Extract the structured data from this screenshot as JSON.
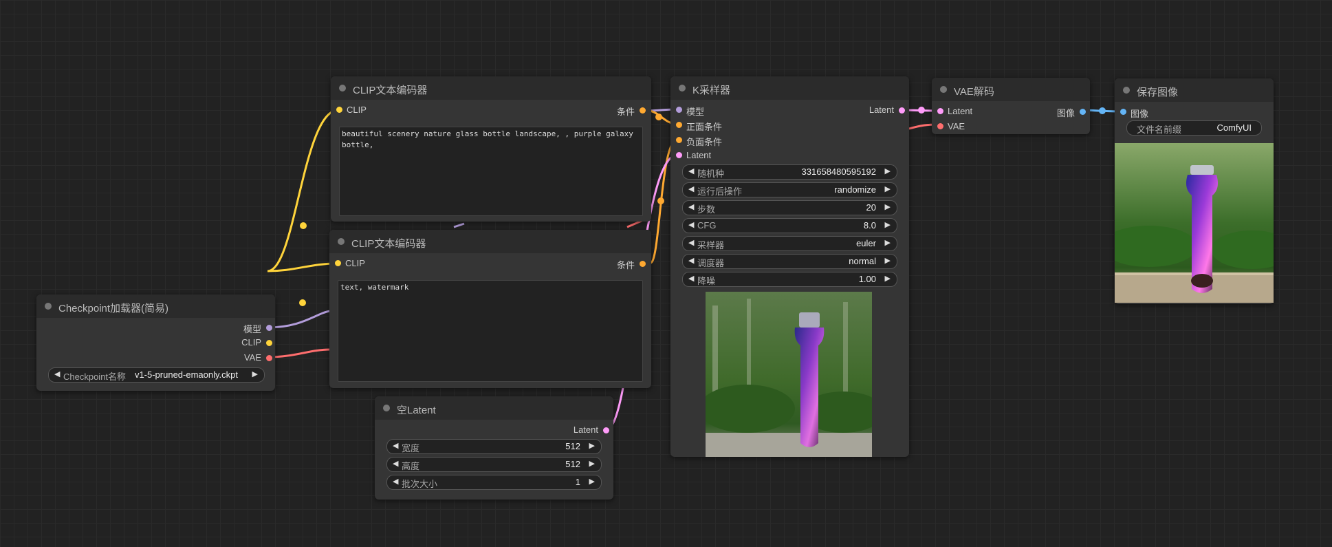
{
  "colors": {
    "clip": "#ffd43b",
    "model": "#b39ddb",
    "vae": "#ff6e6e",
    "latent": "#ff9cf9",
    "cond": "#ffa931",
    "image": "#64b5f6"
  },
  "clip_pos": {
    "title": "CLIP文本编码器",
    "in_clip": "CLIP",
    "out_cond": "条件",
    "text": "beautiful scenery nature glass bottle landscape, , purple galaxy bottle,"
  },
  "clip_neg": {
    "title": "CLIP文本编码器",
    "in_clip": "CLIP",
    "out_cond": "条件",
    "text": "text, watermark"
  },
  "checkpoint": {
    "title": "Checkpoint加载器(简易)",
    "out_model": "模型",
    "out_clip": "CLIP",
    "out_vae": "VAE",
    "ckpt_label": "Checkpoint名称",
    "ckpt_value": "v1-5-pruned-emaonly.ckpt"
  },
  "empty_latent": {
    "title": "空Latent",
    "out_latent": "Latent",
    "width_label": "宽度",
    "width_value": "512",
    "height_label": "高度",
    "height_value": "512",
    "batch_label": "批次大小",
    "batch_value": "1"
  },
  "ksampler": {
    "title": "K采样器",
    "in_model": "模型",
    "in_positive": "正面条件",
    "in_negative": "负面条件",
    "in_latent": "Latent",
    "out_latent": "Latent",
    "widgets": [
      {
        "label": "随机种",
        "value": "331658480595192"
      },
      {
        "label": "运行后操作",
        "value": "randomize"
      },
      {
        "label": "步数",
        "value": "20"
      },
      {
        "label": "CFG",
        "value": "8.0"
      },
      {
        "label": "采样器",
        "value": "euler"
      },
      {
        "label": "调度器",
        "value": "normal"
      },
      {
        "label": "降噪",
        "value": "1.00"
      }
    ]
  },
  "vae_decode": {
    "title": "VAE解码",
    "in_latent": "Latent",
    "in_vae": "VAE",
    "out_image": "图像"
  },
  "save_image": {
    "title": "保存图像",
    "in_image": "图像",
    "prefix_label": "文件名前缀",
    "prefix_value": "ComfyUI"
  }
}
